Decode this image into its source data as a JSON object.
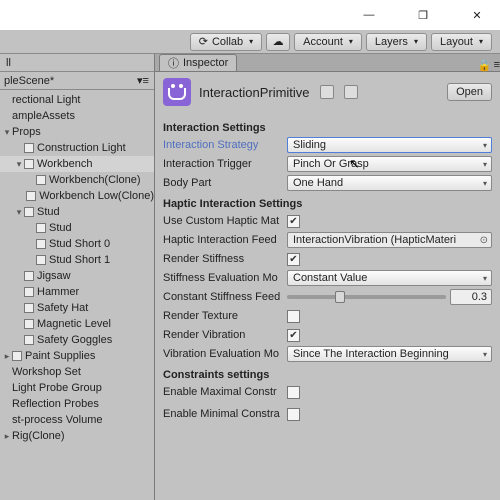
{
  "window": {
    "minimize": "—",
    "maximize": "❐",
    "close": "✕"
  },
  "toolbar": {
    "collab": "Collab",
    "account": "Account",
    "layers": "Layers",
    "layout": "Layout"
  },
  "hierarchy": {
    "tab_suffix": "ll",
    "scene": "pleScene*",
    "items": [
      {
        "label": "rectional Light",
        "indent": 1
      },
      {
        "label": "ampleAssets",
        "indent": 1
      },
      {
        "label": "Props",
        "indent": 1,
        "fold": "▾"
      },
      {
        "label": "Construction Light",
        "indent": 2,
        "box": true
      },
      {
        "label": "Workbench",
        "indent": 2,
        "box": true,
        "fold": "▾",
        "selected": true
      },
      {
        "label": "Workbench(Clone)",
        "indent": 3,
        "box": true
      },
      {
        "label": "Workbench Low(Clone)",
        "indent": 3,
        "box": true
      },
      {
        "label": "Stud",
        "indent": 2,
        "box": true,
        "fold": "▾"
      },
      {
        "label": "Stud",
        "indent": 3,
        "box": true
      },
      {
        "label": "Stud Short 0",
        "indent": 3,
        "box": true
      },
      {
        "label": "Stud Short 1",
        "indent": 3,
        "box": true
      },
      {
        "label": "Jigsaw",
        "indent": 2,
        "box": true
      },
      {
        "label": "Hammer",
        "indent": 2,
        "box": true
      },
      {
        "label": "Safety Hat",
        "indent": 2,
        "box": true
      },
      {
        "label": "Magnetic Level",
        "indent": 2,
        "box": true
      },
      {
        "label": "Safety Goggles",
        "indent": 2,
        "box": true
      },
      {
        "label": "Paint Supplies",
        "indent": 1,
        "box": true,
        "fold": "▸"
      },
      {
        "label": "Workshop Set",
        "indent": 1
      },
      {
        "label": "Light Probe Group",
        "indent": 1
      },
      {
        "label": "Reflection Probes",
        "indent": 1
      },
      {
        "label": "st-process Volume",
        "indent": 1
      },
      {
        "label": "Rig(Clone)",
        "indent": 1,
        "fold": "▸"
      }
    ]
  },
  "inspector": {
    "tab": "Inspector",
    "title": "InteractionPrimitive",
    "open": "Open",
    "sections": {
      "s1": "Interaction Settings",
      "s2": "Haptic Interaction Settings",
      "s3": "Constraints settings"
    },
    "labels": {
      "strategy": "Interaction Strategy",
      "trigger": "Interaction Trigger",
      "bodypart": "Body Part",
      "customMat": "Use Custom Haptic Mat",
      "feed": "Haptic Interaction Feed",
      "renderStiff": "Render Stiffness",
      "stiffMode": "Stiffness Evaluation Mo",
      "constStiff": "Constant Stiffness Feed",
      "renderTex": "Render Texture",
      "renderVib": "Render Vibration",
      "vibMode": "Vibration Evaluation Mo",
      "enMax": "Enable Maximal Constr",
      "enMin": "Enable Minimal Constra"
    },
    "values": {
      "strategy": "Sliding",
      "trigger": "Pinch Or Grasp",
      "bodypart": "One Hand",
      "customMat": true,
      "feed": "InteractionVibration (HapticMateri",
      "renderStiff": true,
      "stiffMode": "Constant Value",
      "constStiffSlider": 0.3,
      "constStiffValue": "0.3",
      "renderTex": false,
      "renderVib": true,
      "vibMode": "Since The Interaction Beginning",
      "enMax": false,
      "enMin": false
    }
  }
}
